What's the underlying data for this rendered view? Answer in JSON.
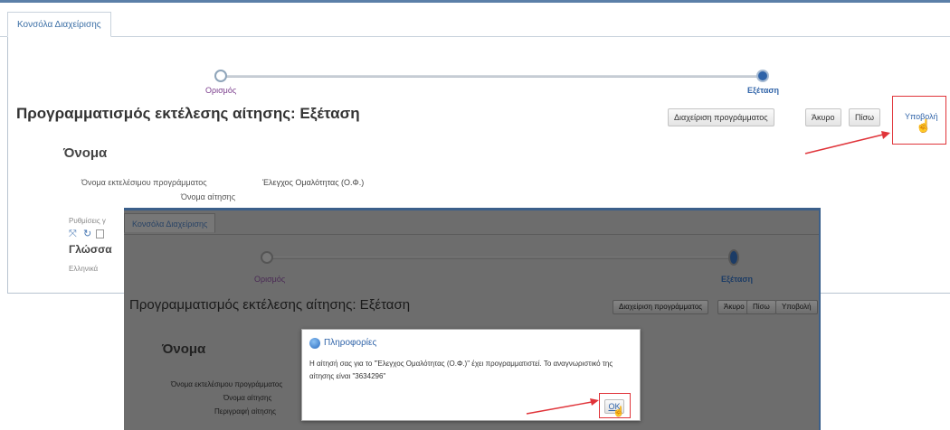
{
  "back_window": {
    "tab": "Κονσόλα Διαχείρισης",
    "train": {
      "step1": "Ορισμός",
      "step2": "Εξέταση"
    },
    "page_title": "Προγραμματισμός εκτέλεσης αίτησης: Εξέταση",
    "buttons": {
      "manage": "Διαχείριση προγράμματος",
      "cancel": "Άκυρο",
      "back": "Πίσω",
      "submit": "Υποβολή"
    },
    "section_name": "Όνομα",
    "program_name_label": "Όνομα εκτελέσιμου προγράμματος",
    "program_name_value": "Έλεγχος Ομαλότητας (Ο.Φ.)",
    "request_name_label": "Όνομα αίτησης",
    "settings_text": "Ρυθμίσεις γ",
    "language_section": "Γλώσσα",
    "language_value": "Ελληνικά"
  },
  "front_window": {
    "tab": "Κονσόλα Διαχείρισης",
    "train": {
      "step1": "Ορισμός",
      "step2": "Εξέταση"
    },
    "page_title": "Προγραμματισμός εκτέλεσης αίτησης: Εξέταση",
    "buttons": {
      "manage": "Διαχείριση προγράμματος",
      "cancel": "Άκυρο",
      "back": "Πίσω",
      "submit": "Υποβολή"
    },
    "section_name": "Όνομα",
    "program_name_label": "Όνομα εκτελέσιμου προγράμματος",
    "request_name_label": "Όνομα αίτησης",
    "description_label": "Περιγραφή αίτησης"
  },
  "dialog": {
    "title": "Πληροφορίες",
    "message_line1": "Η αίτησή σας για το \"Έλεγχος Ομαλότητας (Ο.Φ.)\" έχει προγραμματιστεί. Το αναγνωριστικό της",
    "message_line2": "αίτησης είναι \"3634296\"",
    "ok": "OK"
  },
  "colors": {
    "accent": "#2f63a8",
    "annotation_red": "#e0343a",
    "train_visited": "#7a3c8c"
  },
  "icons": [
    "expand-icon",
    "refresh-icon",
    "info-icon",
    "pointer-cursor-icon",
    "annotation-arrow"
  ]
}
